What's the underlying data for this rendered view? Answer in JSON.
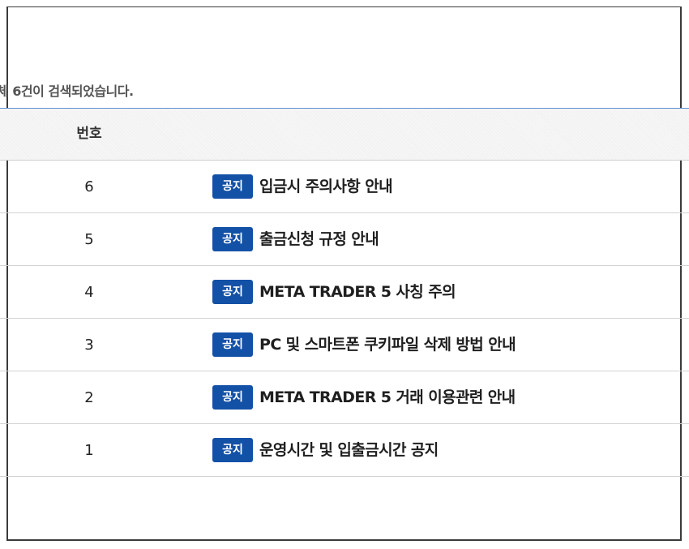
{
  "result_count_text": "체 6건이 검색되었습니다.",
  "table": {
    "header_number": "번호",
    "rows": [
      {
        "number": "6",
        "badge": "공지",
        "title": "입금시 주의사항 안내"
      },
      {
        "number": "5",
        "badge": "공지",
        "title": "출금신청 규정 안내"
      },
      {
        "number": "4",
        "badge": "공지",
        "title": "META TRADER 5 사칭 주의"
      },
      {
        "number": "3",
        "badge": "공지",
        "title": "PC 및 스마트폰 쿠키파일 삭제 방법 안내"
      },
      {
        "number": "2",
        "badge": "공지",
        "title": "META TRADER 5 거래 이용관련 안내"
      },
      {
        "number": "1",
        "badge": "공지",
        "title": "운영시간 및 입출금시간 공지"
      }
    ]
  },
  "colors": {
    "badge_background": "#1351a7",
    "accent_rule": "#5b8fd6",
    "frame_border": "#3a3a3a"
  }
}
